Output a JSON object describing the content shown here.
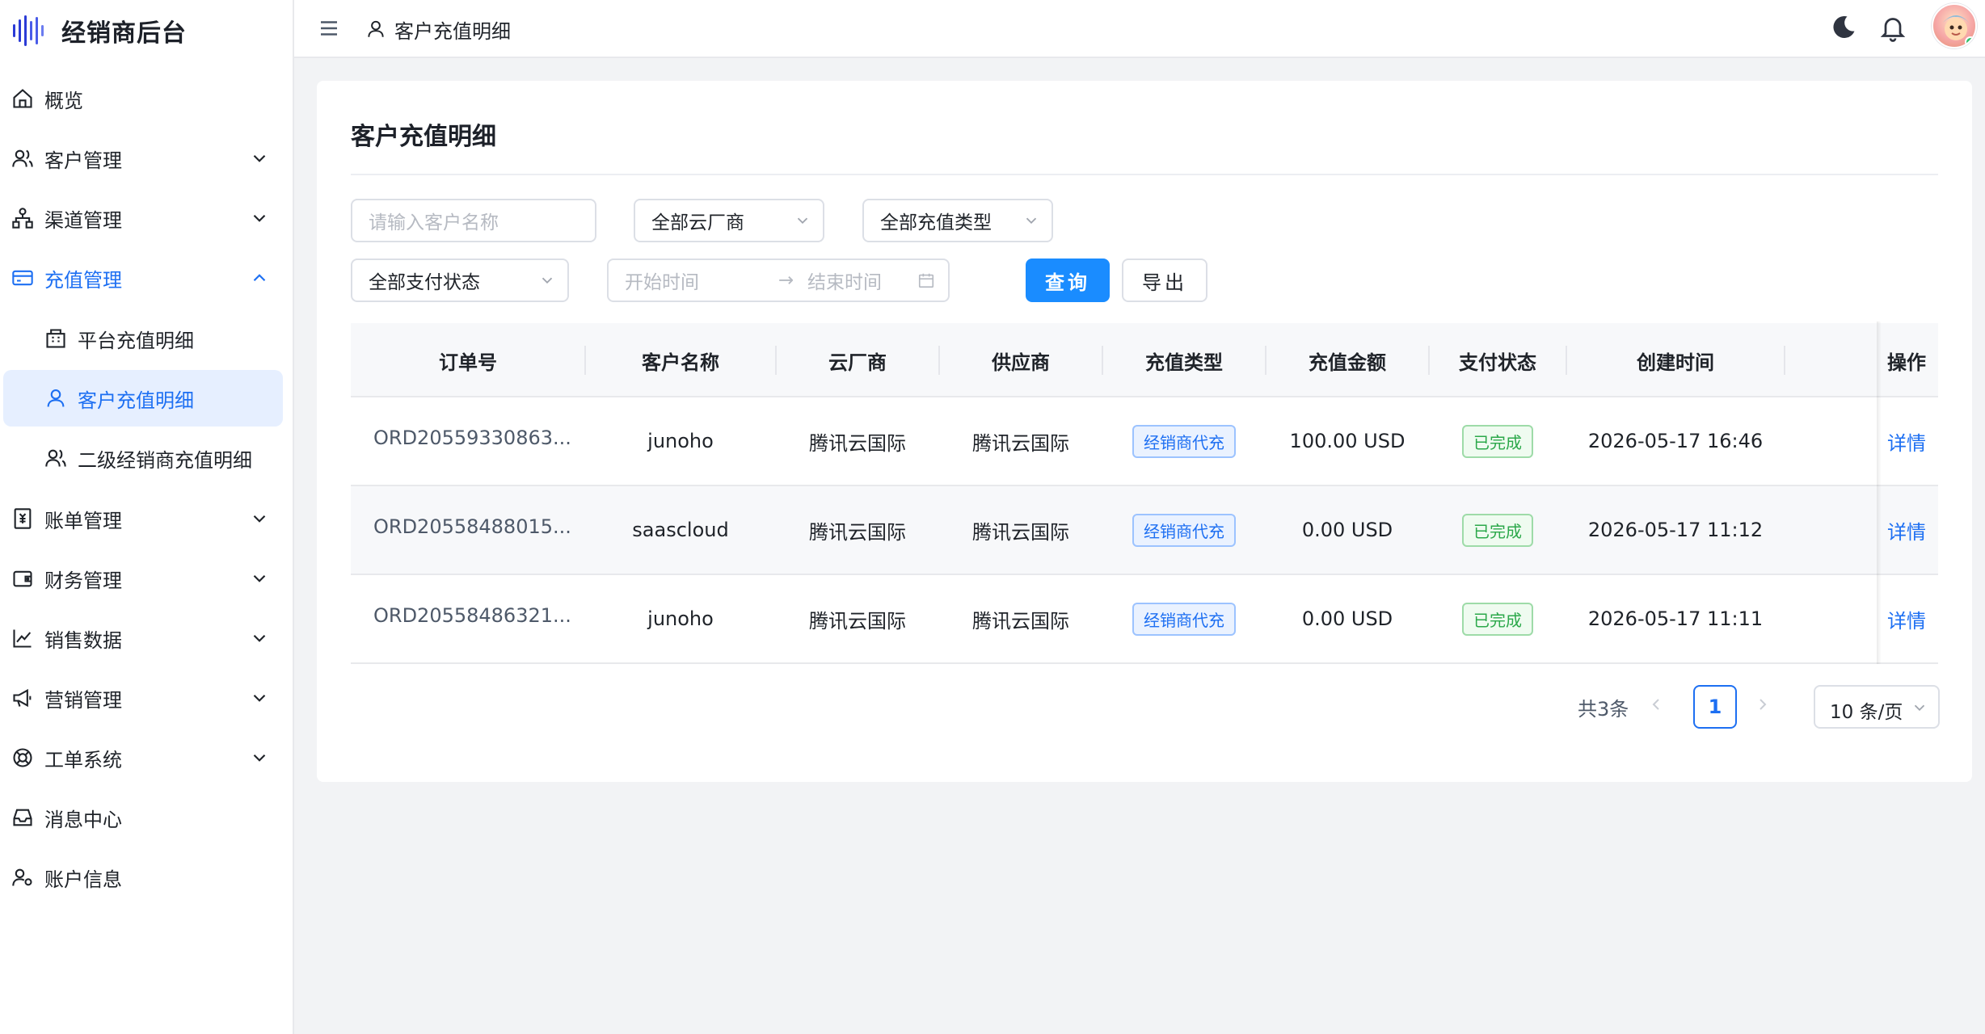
{
  "app": {
    "title": "经销商后台"
  },
  "sidebar": {
    "items": [
      {
        "label": "概览",
        "icon": "home-icon",
        "expandable": false
      },
      {
        "label": "客户管理",
        "icon": "users-icon",
        "expandable": true
      },
      {
        "label": "渠道管理",
        "icon": "channel-icon",
        "expandable": true
      },
      {
        "label": "充值管理",
        "icon": "card-icon",
        "expandable": true,
        "expanded": true,
        "children": [
          {
            "label": "平台充值明细",
            "icon": "building-icon"
          },
          {
            "label": "客户充值明细",
            "icon": "user-icon",
            "selected": true
          },
          {
            "label": "二级经销商充值明细",
            "icon": "users-icon"
          }
        ]
      },
      {
        "label": "账单管理",
        "icon": "bill-icon",
        "expandable": true
      },
      {
        "label": "财务管理",
        "icon": "wallet-icon",
        "expandable": true
      },
      {
        "label": "销售数据",
        "icon": "chart-line-icon",
        "expandable": true
      },
      {
        "label": "营销管理",
        "icon": "megaphone-icon",
        "expandable": true
      },
      {
        "label": "工单系统",
        "icon": "lifebuoy-icon",
        "expandable": true
      },
      {
        "label": "消息中心",
        "icon": "inbox-icon",
        "expandable": false
      },
      {
        "label": "账户信息",
        "icon": "user-settings-icon",
        "expandable": false
      }
    ]
  },
  "header": {
    "breadcrumb": "客户充值明细",
    "icons": [
      "menu-icon",
      "moon-icon",
      "bell-icon"
    ]
  },
  "page": {
    "title": "客户充值明细",
    "filters": {
      "customer_placeholder": "请输入客户名称",
      "cloud_vendor": "全部云厂商",
      "recharge_type": "全部充值类型",
      "pay_status": "全部支付状态",
      "start_placeholder": "开始时间",
      "end_placeholder": "结束时间",
      "range_sep": "→"
    },
    "buttons": {
      "query": "查询",
      "export": "导出"
    }
  },
  "table": {
    "columns": [
      "订单号",
      "客户名称",
      "云厂商",
      "供应商",
      "充值类型",
      "充值金额",
      "支付状态",
      "创建时间",
      "操作"
    ],
    "rows": [
      {
        "order": "ORD20559330863...",
        "customer": "junoho",
        "cloud": "腾讯云国际",
        "supplier": "腾讯云国际",
        "type": "经销商代充",
        "amount": "100.00 USD",
        "status": "已完成",
        "created": "2026-05-17 16:46",
        "action": "详情"
      },
      {
        "order": "ORD20558488015...",
        "customer": "saascloud",
        "cloud": "腾讯云国际",
        "supplier": "腾讯云国际",
        "type": "经销商代充",
        "amount": "0.00 USD",
        "status": "已完成",
        "created": "2026-05-17 11:12",
        "action": "详情"
      },
      {
        "order": "ORD20558486321...",
        "customer": "junoho",
        "cloud": "腾讯云国际",
        "supplier": "腾讯云国际",
        "type": "经销商代充",
        "amount": "0.00 USD",
        "status": "已完成",
        "created": "2026-05-17 11:11",
        "action": "详情"
      }
    ]
  },
  "pagination": {
    "total": "共3条",
    "current": "1",
    "page_size": "10 条/页"
  },
  "colors": {
    "primary": "#1a8cff",
    "link": "#1d6ff2",
    "success": "#2ba84a",
    "selected_bg": "#e6efff"
  }
}
